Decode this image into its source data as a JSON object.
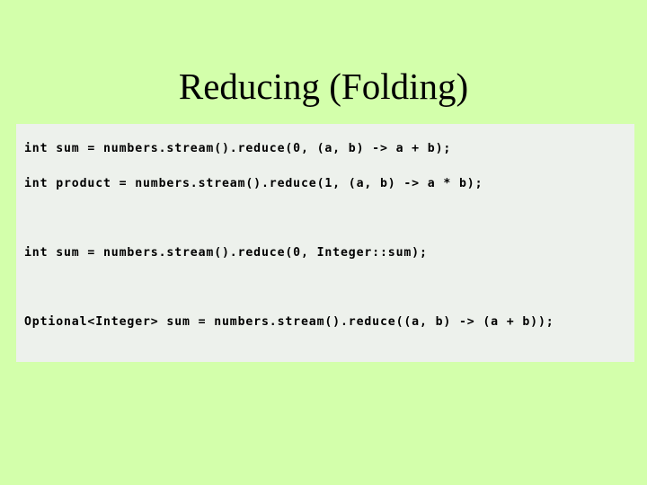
{
  "slide": {
    "title": "Reducing (Folding)",
    "background_color": "#d3ffab",
    "content_box_color": "#edf1ec",
    "text_color": "#000000"
  },
  "code_block": {
    "language": "java",
    "lines": [
      {
        "text": "int sum = numbers.stream().reduce(0, (a, b) -> a + b);",
        "blank_line_before": false
      },
      {
        "text": "int product = numbers.stream().reduce(1, (a, b) -> a * b);",
        "blank_line_before": false
      },
      {
        "text": "int sum = numbers.stream().reduce(0, Integer::sum);",
        "blank_line_before": true
      },
      {
        "text": "Optional<Integer> sum = numbers.stream().reduce((a, b) -> (a + b));",
        "blank_line_before": true
      }
    ]
  }
}
